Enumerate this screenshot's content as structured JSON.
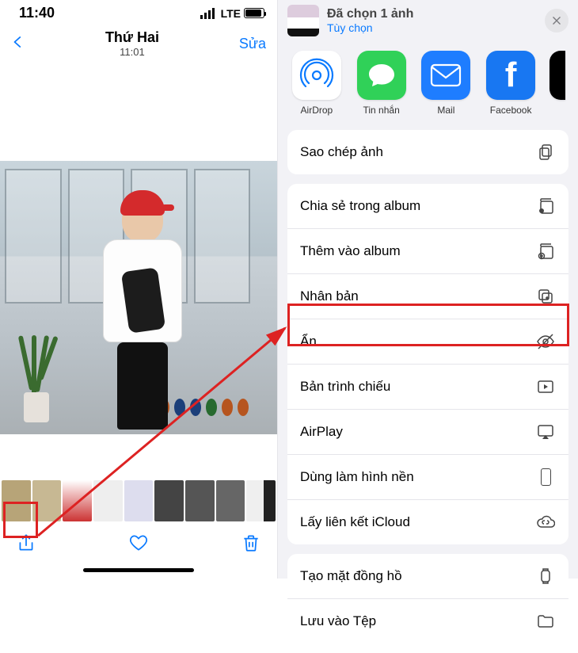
{
  "status": {
    "time": "11:40",
    "network": "LTE"
  },
  "nav": {
    "title": "Thứ Hai",
    "subtitle": "11:01",
    "edit": "Sửa"
  },
  "sheet": {
    "title": "Đã chọn 1 ảnh",
    "subtitle": "Tùy chọn",
    "apps": [
      {
        "id": "airdrop",
        "label": "AirDrop"
      },
      {
        "id": "messages",
        "label": "Tin nhắn"
      },
      {
        "id": "mail",
        "label": "Mail"
      },
      {
        "id": "facebook",
        "label": "Facebook"
      }
    ],
    "actions_group1": [
      {
        "id": "copy",
        "label": "Sao chép ảnh",
        "icon": "copy-icon"
      }
    ],
    "actions_group2": [
      {
        "id": "sharealbum",
        "label": "Chia sẻ trong album",
        "icon": "person-album-icon"
      },
      {
        "id": "addalbum",
        "label": "Thêm vào album",
        "icon": "plus-album-icon"
      },
      {
        "id": "dup",
        "label": "Nhân bản",
        "icon": "duplicate-icon"
      },
      {
        "id": "hide",
        "label": "Ẩn",
        "icon": "hide-icon"
      },
      {
        "id": "slide",
        "label": "Bản trình chiếu",
        "icon": "slideshow-icon"
      },
      {
        "id": "airplay",
        "label": "AirPlay",
        "icon": "airplay-icon"
      },
      {
        "id": "wallpaper",
        "label": "Dùng làm hình nền",
        "icon": "phone-icon"
      },
      {
        "id": "icloud",
        "label": "Lấy liên kết iCloud",
        "icon": "cloud-link-icon"
      }
    ],
    "actions_group3": [
      {
        "id": "watchface",
        "label": "Tạo mặt đồng hồ",
        "icon": "watch-icon"
      },
      {
        "id": "savefile",
        "label": "Lưu vào Tệp",
        "icon": "folder-icon"
      }
    ]
  }
}
